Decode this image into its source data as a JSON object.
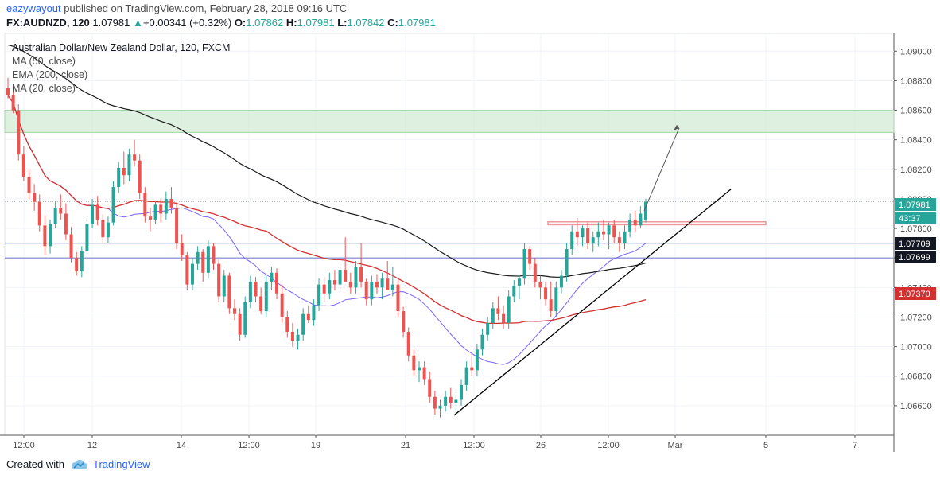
{
  "header": {
    "author": "eazywayout",
    "published": "published on TradingView.com, February 28, 2018 09:16 UTC",
    "symbol_label": "FX:AUDNZD, 120",
    "last": "1.07981",
    "change": "+0.00341 (+0.32%)",
    "o_label": "O:",
    "o": "1.07862",
    "h_label": "H:",
    "h": "1.07981",
    "l_label": "L:",
    "l": "1.07842",
    "c_label": "C:",
    "c": "1.07981",
    "up_arrow": "▲"
  },
  "legend": {
    "title": "Australian Dollar/New Zealand Dollar, 120, FXCM",
    "ma50": "MA (50, close)",
    "ema200": "EMA (200, close)",
    "ma20": "MA (20, close)"
  },
  "footer": {
    "created": "Created with",
    "brand": "TradingView"
  },
  "colors": {
    "up": "#26a69a",
    "down": "#ef5350",
    "ma50": "#d32f2f",
    "ema200": "#1a1a1a",
    "ma20": "#7b61ff",
    "zone": "#a5d6a7",
    "support": "#3f51b5",
    "resistance": "#ef9a9a"
  },
  "chart_data": {
    "type": "candlestick",
    "y_axis_ticks": [
      "1.09000",
      "1.08800",
      "1.08600",
      "1.08400",
      "1.08200",
      "1.08000",
      "1.07800",
      "1.07600",
      "1.07400",
      "1.07200",
      "1.07000",
      "1.06800",
      "1.06600"
    ],
    "x_axis_ticks": [
      "12:00",
      "12",
      "14",
      "12:00",
      "19",
      "21",
      "12:00",
      "26",
      "12:00",
      "Mar",
      "5",
      "7"
    ],
    "price_labels": [
      {
        "text": "1.07981",
        "kind": "last"
      },
      {
        "text": "43:37",
        "kind": "countdown"
      },
      {
        "text": "1.07709",
        "kind": "ema200"
      },
      {
        "text": "1.07699",
        "kind": "ma20"
      },
      {
        "text": "1.07370",
        "kind": "ma50"
      }
    ],
    "ohlc": [
      [
        1.0875,
        1.0882,
        1.0868,
        1.087
      ],
      [
        1.087,
        1.0876,
        1.0858,
        1.086
      ],
      [
        1.086,
        1.0864,
        1.0826,
        1.083
      ],
      [
        1.083,
        1.0836,
        1.0812,
        1.0815
      ],
      [
        1.0815,
        1.082,
        1.08,
        1.0804
      ],
      [
        1.0804,
        1.081,
        1.0792,
        1.0798
      ],
      [
        1.0798,
        1.0803,
        1.0778,
        1.0782
      ],
      [
        1.0782,
        1.0789,
        1.0762,
        1.0768
      ],
      [
        1.0768,
        1.0786,
        1.0763,
        1.0783
      ],
      [
        1.0783,
        1.0798,
        1.078,
        1.0794
      ],
      [
        1.0794,
        1.0803,
        1.0786,
        1.079
      ],
      [
        1.079,
        1.0797,
        1.0772,
        1.0776
      ],
      [
        1.0776,
        1.0781,
        1.0757,
        1.076
      ],
      [
        1.076,
        1.0764,
        1.0748,
        1.0751
      ],
      [
        1.0751,
        1.0768,
        1.0747,
        1.0765
      ],
      [
        1.0765,
        1.0787,
        1.0762,
        1.0783
      ],
      [
        1.0783,
        1.08,
        1.078,
        1.0796
      ],
      [
        1.0796,
        1.0802,
        1.0782,
        1.0786
      ],
      [
        1.0786,
        1.079,
        1.077,
        1.0774
      ],
      [
        1.0774,
        1.0788,
        1.077,
        1.0784
      ],
      [
        1.0784,
        1.0812,
        1.0782,
        1.0808
      ],
      [
        1.0808,
        1.0825,
        1.0804,
        1.0821
      ],
      [
        1.0821,
        1.0832,
        1.081,
        1.0816
      ],
      [
        1.0816,
        1.0834,
        1.0812,
        1.083
      ],
      [
        1.083,
        1.084,
        1.0822,
        1.0826
      ],
      [
        1.0826,
        1.083,
        1.08,
        1.0804
      ],
      [
        1.0804,
        1.0808,
        1.0784,
        1.0788
      ],
      [
        1.0788,
        1.0794,
        1.0778,
        1.0786
      ],
      [
        1.0786,
        1.0799,
        1.0783,
        1.0796
      ],
      [
        1.0796,
        1.08,
        1.0784,
        1.079
      ],
      [
        1.079,
        1.0805,
        1.0786,
        1.08
      ],
      [
        1.08,
        1.0808,
        1.079,
        1.0794
      ],
      [
        1.0794,
        1.0798,
        1.0766,
        1.077
      ],
      [
        1.077,
        1.0776,
        1.0758,
        1.0762
      ],
      [
        1.0762,
        1.0764,
        1.0738,
        1.0742
      ],
      [
        1.0742,
        1.076,
        1.0738,
        1.0756
      ],
      [
        1.0756,
        1.0768,
        1.0752,
        1.0764
      ],
      [
        1.0764,
        1.0766,
        1.0744,
        1.075
      ],
      [
        1.075,
        1.0772,
        1.0746,
        1.0768
      ],
      [
        1.0768,
        1.077,
        1.0752,
        1.0756
      ],
      [
        1.0756,
        1.0759,
        1.073,
        1.0734
      ],
      [
        1.0734,
        1.0752,
        1.073,
        1.0748
      ],
      [
        1.0748,
        1.075,
        1.0722,
        1.0726
      ],
      [
        1.0726,
        1.0732,
        1.0718,
        1.0722
      ],
      [
        1.0722,
        1.0726,
        1.0704,
        1.0708
      ],
      [
        1.0708,
        1.0734,
        1.0706,
        1.073
      ],
      [
        1.073,
        1.0748,
        1.0726,
        1.0744
      ],
      [
        1.0744,
        1.0747,
        1.073,
        1.0734
      ],
      [
        1.0734,
        1.074,
        1.0722,
        1.0724
      ],
      [
        1.0724,
        1.0748,
        1.072,
        1.0744
      ],
      [
        1.0744,
        1.0754,
        1.0738,
        1.075
      ],
      [
        1.075,
        1.0753,
        1.0732,
        1.0736
      ],
      [
        1.0736,
        1.0742,
        1.0716,
        1.072
      ],
      [
        1.072,
        1.0724,
        1.0706,
        1.071
      ],
      [
        1.071,
        1.0716,
        1.07,
        1.0704
      ],
      [
        1.0704,
        1.0712,
        1.0698,
        1.0708
      ],
      [
        1.0708,
        1.0726,
        1.0704,
        1.0722
      ],
      [
        1.0722,
        1.0728,
        1.0716,
        1.0718
      ],
      [
        1.0718,
        1.0732,
        1.0714,
        1.0728
      ],
      [
        1.0728,
        1.0746,
        1.0724,
        1.0742
      ],
      [
        1.0742,
        1.0747,
        1.073,
        1.0736
      ],
      [
        1.0736,
        1.075,
        1.0732,
        1.0745
      ],
      [
        1.0745,
        1.0752,
        1.0738,
        1.0742
      ],
      [
        1.0742,
        1.0756,
        1.0738,
        1.0752
      ],
      [
        1.0752,
        1.0774,
        1.0748,
        1.0744
      ],
      [
        1.0744,
        1.075,
        1.0736,
        1.074
      ],
      [
        1.074,
        1.0758,
        1.0736,
        1.0754
      ],
      [
        1.0754,
        1.077,
        1.074,
        1.0744
      ],
      [
        1.0744,
        1.0746,
        1.0728,
        1.0732
      ],
      [
        1.0732,
        1.0748,
        1.0728,
        1.0744
      ],
      [
        1.0744,
        1.0749,
        1.0736,
        1.074
      ],
      [
        1.074,
        1.075,
        1.0732,
        1.0746
      ],
      [
        1.0746,
        1.0758,
        1.0742,
        1.0738
      ],
      [
        1.0738,
        1.0754,
        1.0734,
        1.0742
      ],
      [
        1.0742,
        1.0745,
        1.072,
        1.0724
      ],
      [
        1.0724,
        1.0727,
        1.0706,
        1.071
      ],
      [
        1.071,
        1.0713,
        1.069,
        1.0694
      ],
      [
        1.0694,
        1.0698,
        1.068,
        1.0684
      ],
      [
        1.0684,
        1.069,
        1.0676,
        1.0686
      ],
      [
        1.0686,
        1.069,
        1.0674,
        1.0678
      ],
      [
        1.0678,
        1.0683,
        1.0662,
        1.0666
      ],
      [
        1.0666,
        1.067,
        1.0654,
        1.0658
      ],
      [
        1.0658,
        1.0664,
        1.0652,
        1.066
      ],
      [
        1.066,
        1.067,
        1.0656,
        1.0666
      ],
      [
        1.0666,
        1.0672,
        1.0658,
        1.0662
      ],
      [
        1.0662,
        1.0668,
        1.0654,
        1.0664
      ],
      [
        1.0664,
        1.0678,
        1.066,
        1.0674
      ],
      [
        1.0674,
        1.069,
        1.067,
        1.0686
      ],
      [
        1.0686,
        1.0695,
        1.068,
        1.0684
      ],
      [
        1.0684,
        1.0702,
        1.068,
        1.0698
      ],
      [
        1.0698,
        1.0712,
        1.0694,
        1.0708
      ],
      [
        1.0708,
        1.072,
        1.0704,
        1.0716
      ],
      [
        1.0716,
        1.073,
        1.0712,
        1.0726
      ],
      [
        1.0726,
        1.0734,
        1.0718,
        1.0722
      ],
      [
        1.0722,
        1.0728,
        1.0712,
        1.0716
      ],
      [
        1.0716,
        1.0738,
        1.0712,
        1.0734
      ],
      [
        1.0734,
        1.0745,
        1.073,
        1.0741
      ],
      [
        1.0741,
        1.0748,
        1.0732,
        1.0746
      ],
      [
        1.0746,
        1.077,
        1.0742,
        1.0766
      ],
      [
        1.0766,
        1.0768,
        1.0752,
        1.0756
      ],
      [
        1.0756,
        1.076,
        1.074,
        1.0744
      ],
      [
        1.0744,
        1.0748,
        1.0732,
        1.074
      ],
      [
        1.074,
        1.0744,
        1.0728,
        1.0732
      ],
      [
        1.0732,
        1.0744,
        1.072,
        1.0724
      ],
      [
        1.0724,
        1.0744,
        1.072,
        1.074
      ],
      [
        1.074,
        1.0752,
        1.0736,
        1.0748
      ],
      [
        1.0748,
        1.077,
        1.0744,
        1.0766
      ],
      [
        1.0766,
        1.0782,
        1.0762,
        1.0778
      ],
      [
        1.0778,
        1.0787,
        1.0768,
        1.0774
      ],
      [
        1.0774,
        1.0782,
        1.0768,
        1.078
      ],
      [
        1.078,
        1.0784,
        1.0766,
        1.077
      ],
      [
        1.077,
        1.0778,
        1.0764,
        1.0774
      ],
      [
        1.0774,
        1.0784,
        1.0768,
        1.0778
      ],
      [
        1.0778,
        1.0786,
        1.0772,
        1.0776
      ],
      [
        1.0776,
        1.0784,
        1.0766,
        1.0782
      ],
      [
        1.0782,
        1.0786,
        1.077,
        1.0774
      ],
      [
        1.0774,
        1.0778,
        1.0764,
        1.077
      ],
      [
        1.077,
        1.0782,
        1.0766,
        1.0778
      ],
      [
        1.0778,
        1.079,
        1.0774,
        1.0786
      ],
      [
        1.0786,
        1.0792,
        1.0778,
        1.0782
      ],
      [
        1.0782,
        1.0795,
        1.078,
        1.079
      ],
      [
        1.0786,
        1.08,
        1.0784,
        1.0798
      ]
    ],
    "overlays": {
      "ma50_label": "MA (50, close)",
      "ema200_label": "EMA (200, close)",
      "ma20_label": "MA (20, close)"
    },
    "drawings": {
      "target_zone": [
        1.0845,
        1.086
      ],
      "support_line_levels": [
        1.077,
        1.076
      ],
      "resistance_box": [
        1.07825,
        1.07845
      ],
      "trendline_from": 1.06535,
      "trendline_to": 1.08065
    },
    "y_range": [
      1.064,
      1.0912
    ]
  }
}
